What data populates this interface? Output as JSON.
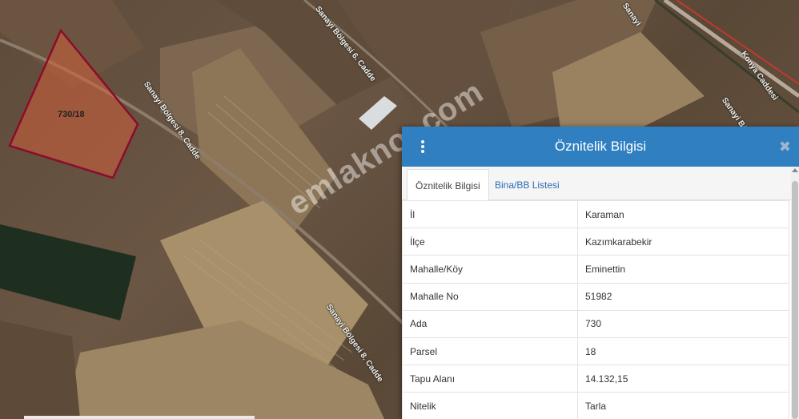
{
  "map": {
    "parcel_label": "730/18",
    "watermark": "emlakno..com",
    "roads": {
      "road_6": "Sanayi Bölgesi 6. Cadde",
      "road_8_upper": "Sanayi Bölgesi 8. Cadde",
      "road_8_lower": "Sanayi Bölgesi 8. Cadde",
      "sanayi_top": "Sanayi",
      "konya": "Konya Caddesi",
      "sanayi_right": "Sanayi Bö"
    },
    "colors": {
      "parcel_fill": "#d2603a",
      "parcel_stroke": "#8b0c2a",
      "field_dark": "#1f2f1f",
      "field_light": "#a8906a"
    }
  },
  "panel": {
    "title": "Öznitelik Bilgisi",
    "menu_icon": "vertical-dots-icon",
    "close_icon": "close-icon",
    "tabs": [
      "Öznitelik Bilgisi",
      "Bina/BB Listesi"
    ],
    "active_tab": "Öznitelik Bilgisi",
    "rows": [
      {
        "key": "İl",
        "value": "Karaman"
      },
      {
        "key": "İlçe",
        "value": "Kazımkarabekir"
      },
      {
        "key": "Mahalle/Köy",
        "value": "Eminettin"
      },
      {
        "key": "Mahalle No",
        "value": "51982"
      },
      {
        "key": "Ada",
        "value": "730"
      },
      {
        "key": "Parsel",
        "value": "18"
      },
      {
        "key": "Tapu Alanı",
        "value": "14.132,15"
      },
      {
        "key": "Nitelik",
        "value": "Tarla"
      }
    ],
    "header_color": "#2f7fc1"
  }
}
